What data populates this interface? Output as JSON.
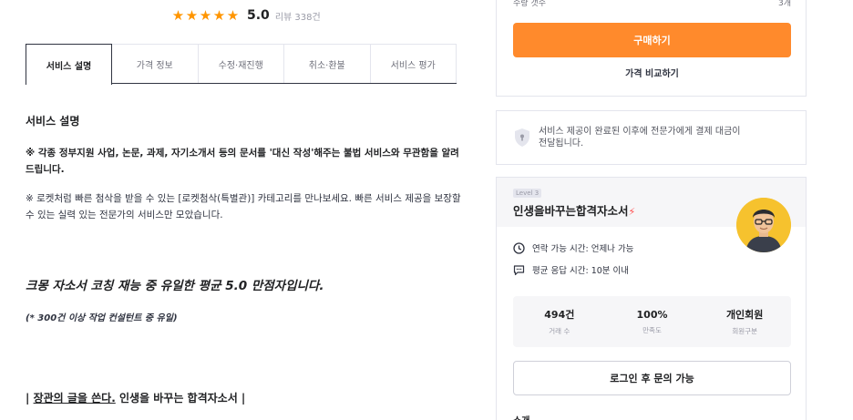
{
  "rating": {
    "stars": [
      "★",
      "★",
      "★",
      "★",
      "★"
    ],
    "score": "5.0",
    "review_count": "리뷰 338건",
    "star_color": "#ff9500"
  },
  "tabs": [
    {
      "label": "서비스 설명"
    },
    {
      "label": "가격 정보"
    },
    {
      "label": "수정·재진행"
    },
    {
      "label": "취소·환불"
    },
    {
      "label": "서비스 평가"
    }
  ],
  "description": {
    "title": "서비스 설명",
    "notice_1": "※ 각종 정부지원 사업, 논문, 과제, 자기소개서 등의 문서를 '대신 작성'해주는 불법 서비스와 무관함을 알려 드립니다.",
    "notice_2": "※ 로켓처럼 빠른 첨삭을 받을 수 있는 [로켓첨삭(특별관)] 카테고리를 만나보세요. 빠른 서비스 제공을 보장할 수 있는 실력 있는 전문가의 서비스만 모았습니다.",
    "headline": "크몽 자소서 코칭 재능 중 유일한 평균 5.0 만점자입니다.",
    "sub_headline": "(* 300건 이상 작업 컨설턴트 중 유일)",
    "slogan_prefix": "| ",
    "slogan_underlined": "장관의 글을 쓴다.",
    "slogan_suffix": " 인생을 바꾸는 합격자소서 |"
  },
  "purchase": {
    "qty_label": "수량 갯수",
    "qty_value": "3개",
    "buy_label": "구매하기",
    "compare_label": "가격 비교하기",
    "accent": "#ff8a2c"
  },
  "notice": {
    "text_line1": "서비스 제공이 완료된 이후에 전문가에게 결제 대금이",
    "text_line2": "전달됩니다."
  },
  "expert": {
    "level": "Level 3",
    "name": "인생을바꾸는합격자소서",
    "bolt": "⚡",
    "contact_time": "연락 가능 시간: 언제나 가능",
    "response_time": "평균 응답 시간: 10분 이내",
    "stats": [
      {
        "value": "494건",
        "label": "거래 수"
      },
      {
        "value": "100%",
        "label": "만족도"
      },
      {
        "value": "개인회원",
        "label": "회원구분"
      }
    ],
    "login_label": "로그인 후 문의 가능",
    "intro_label": "소개"
  }
}
